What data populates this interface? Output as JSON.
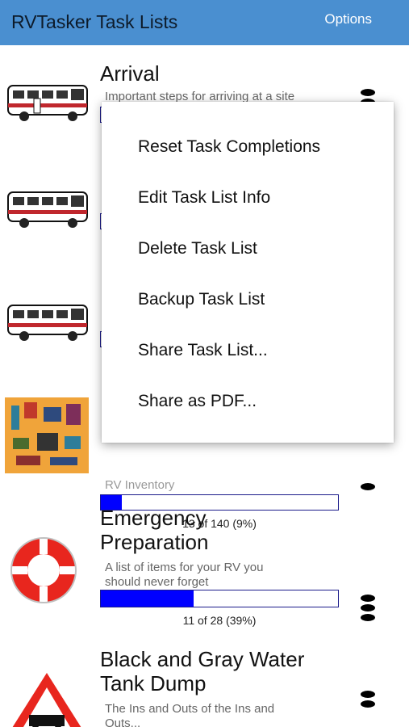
{
  "appbar": {
    "title": "RVTasker Task Lists",
    "options_label": "Options"
  },
  "task_lists": [
    {
      "title": "Arrival",
      "description": "Important steps for arriving at a site",
      "icon": "rv-motorhome-icon"
    },
    {
      "icon": "rv-motorhome-icon"
    },
    {
      "icon": "rv-motorhome-icon"
    },
    {
      "description": "RV Inventory",
      "progress_text": "13 of 140 (9%)",
      "progress": 0.09,
      "icon": "tools-inventory-icon"
    },
    {
      "title_line1": "Emergency",
      "title_line2": "Preparation",
      "description_line1": "A list of items for your RV you",
      "description_line2": "should never forget",
      "progress_text": "11 of 28 (39%)",
      "progress": 0.39,
      "icon": "life-ring-icon"
    },
    {
      "title_line1": "Black and Gray Water",
      "title_line2": "Tank Dump",
      "description_line1": "The Ins and Outs of the Ins and",
      "description_line2": "Outs...",
      "icon": "road-warning-sign-icon"
    }
  ],
  "context_menu": {
    "items": [
      "Reset Task Completions",
      "Edit Task List Info",
      "Delete Task List",
      "Backup Task List",
      "Share Task List...",
      "Share as PDF..."
    ]
  },
  "colors": {
    "appbar": "#4a8fd0",
    "progress_fill": "#0000ff",
    "progress_border": "#1a1a8a"
  }
}
